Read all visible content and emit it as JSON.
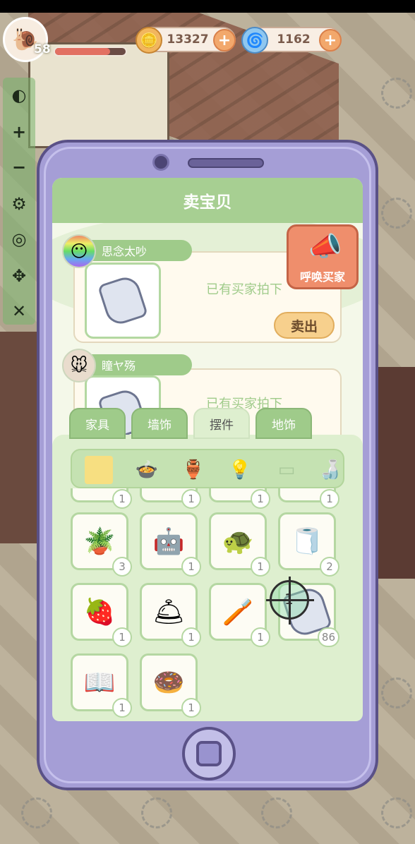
{
  "hud": {
    "level": "58",
    "hp_fraction": 0.78,
    "coins": "13327",
    "gems": "1162",
    "plus": "+"
  },
  "tools": [
    "+",
    "−",
    "⚙",
    "◎",
    "✥",
    "✕"
  ],
  "phone": {
    "title": "卖宝贝",
    "summon_label": "呼唤买家",
    "listings": [
      {
        "seller": "思念太吵",
        "status": "已有买家拍下",
        "button": "卖出"
      },
      {
        "seller": "瞳ヤ殇",
        "status": "已有买家拍下",
        "button": ""
      }
    ],
    "tabs": [
      {
        "label": "家具",
        "active": false
      },
      {
        "label": "墙饰",
        "active": false
      },
      {
        "label": "摆件",
        "active": true
      },
      {
        "label": "地饰",
        "active": false
      }
    ],
    "categories": [
      "grid-icon",
      "pot-icon",
      "vase-icon",
      "lamp-icon",
      "frame-icon",
      "bottle-icon"
    ],
    "inventory": [
      {
        "icon": "",
        "count": "1"
      },
      {
        "icon": "",
        "count": "1"
      },
      {
        "icon": "",
        "count": "1"
      },
      {
        "icon": "",
        "count": "1"
      },
      {
        "icon": "🪴",
        "count": "3"
      },
      {
        "icon": "🤖",
        "count": "1"
      },
      {
        "icon": "🐢",
        "count": "1"
      },
      {
        "icon": "🧻",
        "count": "2"
      },
      {
        "icon": "🍓",
        "count": "1"
      },
      {
        "icon": "🛎",
        "count": "1"
      },
      {
        "icon": "🪥",
        "count": "1"
      },
      {
        "icon": "",
        "count": "86"
      },
      {
        "icon": "📖",
        "count": "1"
      },
      {
        "icon": "🍩",
        "count": "1"
      }
    ],
    "crosshair_number": "1"
  }
}
